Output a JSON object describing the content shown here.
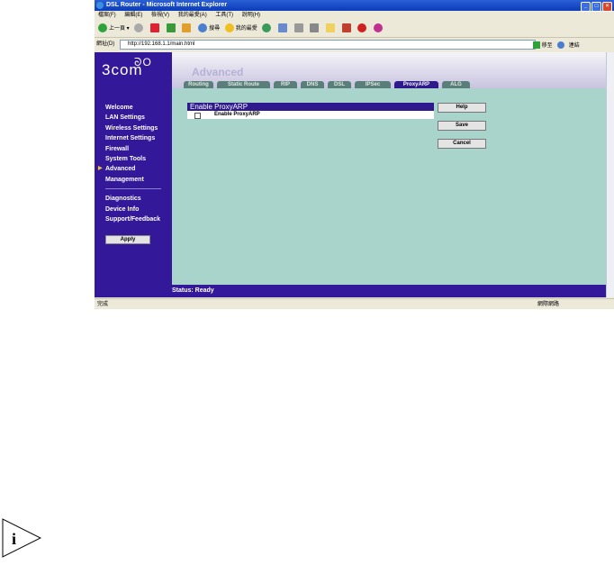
{
  "window": {
    "title": "DSL Router - Microsoft Internet Explorer",
    "controls": {
      "minimize": "_",
      "maximize": "□",
      "close": "×"
    }
  },
  "menubar": [
    "檔案(F)",
    "編輯(E)",
    "檢視(V)",
    "我的最愛(A)",
    "工具(T)",
    "說明(H)"
  ],
  "toolbar": {
    "back": "上一頁",
    "search": "搜尋",
    "favorites": "我的最愛"
  },
  "addressbar": {
    "label": "網址(D)",
    "url": "http://192.168.1.1/main.html",
    "go": "移至",
    "links": "連結"
  },
  "router": {
    "logo": "3com",
    "page_title": "Advanced",
    "tabs": [
      "Routing",
      "Static Route",
      "RIP",
      "DNS",
      "DSL",
      "IPSec",
      "ProxyARP",
      "ALG"
    ],
    "active_tab": "ProxyARP",
    "nav": {
      "welcome": "Welcome",
      "lan": "LAN Settings",
      "wireless": "Wireless Settings",
      "internet": "Internet Settings",
      "firewall": "Firewall",
      "tools": "System Tools",
      "advanced": "Advanced",
      "management": "Management",
      "diagnostics": "Diagnostics",
      "deviceinfo": "Device Info",
      "support": "Support/Feedback"
    },
    "apply": "Apply",
    "panel": {
      "title": "Enable ProxyARP",
      "checkbox_label": "Enable ProxyARP",
      "checked": false
    },
    "buttons": {
      "help": "Help",
      "save": "Save",
      "cancel": "Cancel"
    },
    "status": "Status: Ready"
  },
  "ie_status": {
    "left": "完成",
    "right": "網際網路"
  },
  "note_icon": "info-icon"
}
